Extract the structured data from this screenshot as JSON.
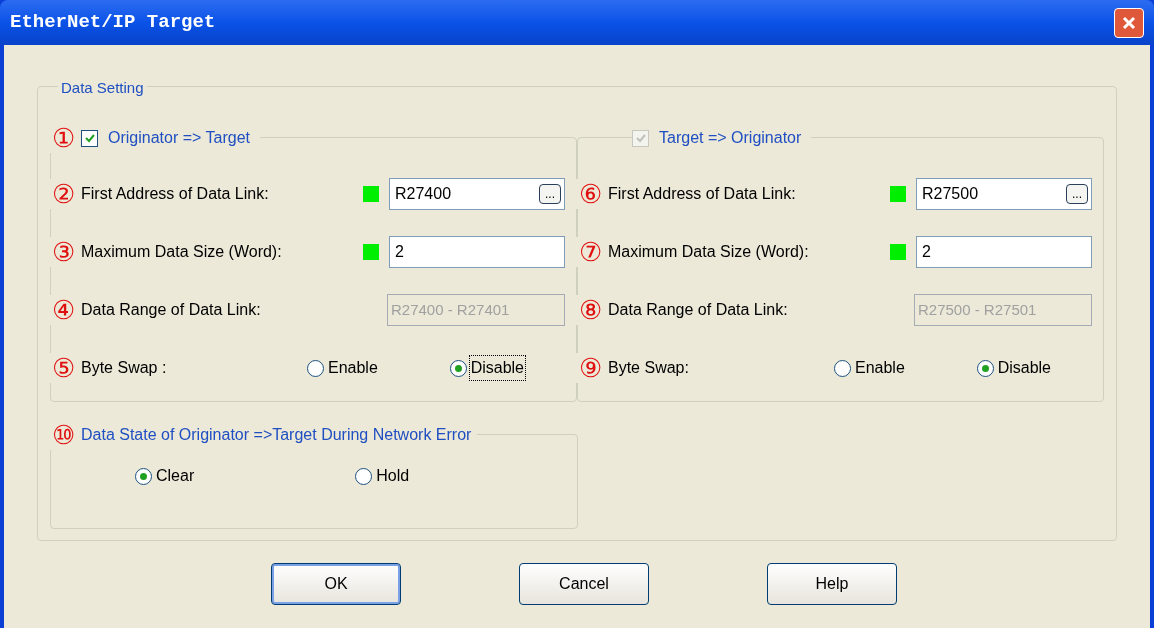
{
  "window": {
    "title": "EtherNet/IP Target"
  },
  "data_setting": {
    "title": "Data Setting",
    "directions": [
      {
        "marker": "①",
        "label": "Originator => Target",
        "checked": true,
        "disabled": false,
        "rows": [
          {
            "kind": "address",
            "marker": "②",
            "label": "First Address of Data Link:",
            "value": "R27400",
            "browse": "..."
          },
          {
            "kind": "size",
            "marker": "③",
            "label": "Maximum Data Size (Word):",
            "value": "2"
          },
          {
            "kind": "range",
            "marker": "④",
            "label": "Data Range of Data Link:",
            "value": "R27400 - R27401"
          },
          {
            "kind": "choice",
            "marker": "⑤",
            "label": "Byte Swap :",
            "options": [
              {
                "label": "Enable",
                "selected": false,
                "focused": false
              },
              {
                "label": "Disable",
                "selected": true,
                "focused": true
              }
            ]
          }
        ]
      },
      {
        "label": "Target => Originator",
        "checked": true,
        "disabled": true,
        "rows": [
          {
            "kind": "address",
            "marker": "⑥",
            "label": "First Address of Data Link:",
            "value": "R27500",
            "browse": "..."
          },
          {
            "kind": "size",
            "marker": "⑦",
            "label": "Maximum Data Size (Word):",
            "value": "2"
          },
          {
            "kind": "range",
            "marker": "⑧",
            "label": "Data Range of Data Link:",
            "value": "R27500 - R27501"
          },
          {
            "kind": "choice",
            "marker": "⑨",
            "label": "Byte Swap:",
            "options": [
              {
                "label": "Enable",
                "selected": false,
                "focused": false
              },
              {
                "label": "Disable",
                "selected": true,
                "focused": false
              }
            ]
          }
        ]
      }
    ],
    "network_error": {
      "marker": "⑩",
      "title": "Data State of Originator =>Target During Network Error",
      "options": [
        {
          "label": "Clear",
          "selected": true,
          "focused": false
        },
        {
          "label": "Hold",
          "selected": false,
          "focused": false
        }
      ]
    }
  },
  "buttons": [
    {
      "label": "OK",
      "default": true
    },
    {
      "label": "Cancel",
      "default": false
    },
    {
      "label": "Help",
      "default": false
    }
  ]
}
